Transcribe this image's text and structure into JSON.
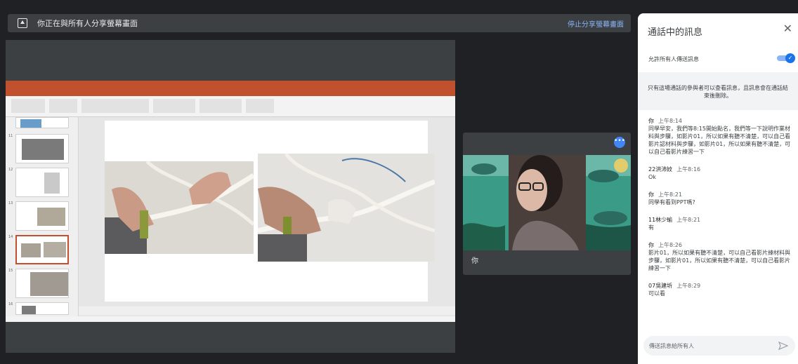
{
  "share_banner": {
    "text": "你正在與所有人分享螢幕畫面",
    "stop_label": "停止分享螢幕畫面"
  },
  "presentation": {
    "thumb_numbers": [
      "11",
      "12",
      "13",
      "14",
      "15",
      "16"
    ]
  },
  "video_tile": {
    "name": "你"
  },
  "chat": {
    "title": "通話中的訊息",
    "allow_label": "允許所有人傳送訊息",
    "info": "只有這場通話的參與者可以查看訊息，且訊息會在通話結束後刪除。",
    "messages": [
      {
        "sender": "你",
        "time": "上午8:14",
        "text": "同學早安，我們等8:15開始點名，我們等一下說明作業材料與步驟，如影片01，所以如果有聽不清楚，可以自己看影片認材料與步驟，如影片01，所以如果有聽不清楚，可以自己看影片練習一下"
      },
      {
        "sender": "22洪沛妏",
        "time": "上午8:16",
        "text": "Ok"
      },
      {
        "sender": "你",
        "time": "上午8:21",
        "text": "同學有看到PPT嗎?"
      },
      {
        "sender": "11林少瑜",
        "time": "上午8:21",
        "text": "有"
      },
      {
        "sender": "你",
        "time": "上午8:26",
        "text": "影片01，所以如果有聽不清楚，可以自己看影片練材料與步驟，如影片01，所以如果有聽不清楚，可以自己看影片練習一下"
      },
      {
        "sender": "07吳建圻",
        "time": "上午8:29",
        "text": "可以看"
      }
    ],
    "input_placeholder": "傳送訊息給所有人"
  },
  "colors": {
    "accent": "#1a73e8",
    "ppt_accent": "#c0502e",
    "link": "#8ab4f8"
  }
}
